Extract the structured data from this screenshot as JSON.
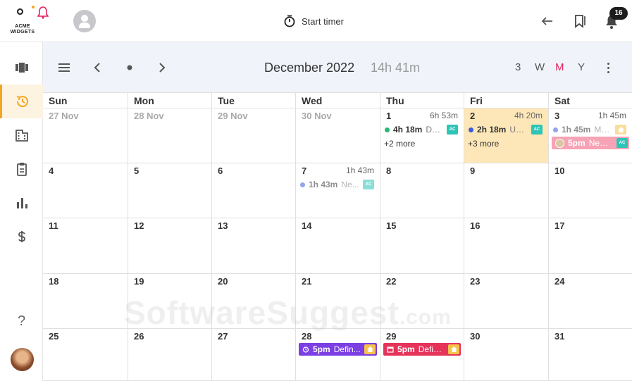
{
  "app": {
    "logo_text": "ACME WIDGETS",
    "notification_count": "16",
    "timer_label": "Start timer"
  },
  "toolbar": {
    "month_label": "December 2022",
    "total_time": "14h 41m",
    "views": [
      "3",
      "W",
      "M",
      "Y"
    ],
    "active_view": "M"
  },
  "weekdays": [
    "Sun",
    "Mon",
    "Tue",
    "Wed",
    "Thu",
    "Fri",
    "Sat"
  ],
  "weeks": [
    [
      {
        "day": "27 Nov",
        "muted": true
      },
      {
        "day": "28 Nov",
        "muted": true
      },
      {
        "day": "29 Nov",
        "muted": true
      },
      {
        "day": "30 Nov",
        "muted": true
      },
      {
        "day": "1",
        "duration": "6h 53m",
        "entries": [
          {
            "time": "4h 18m",
            "desc": "Defi...",
            "dot": "#2bb673",
            "tag": "AC"
          }
        ],
        "more": "+2 more"
      },
      {
        "day": "2",
        "duration": "4h 20m",
        "highlight": true,
        "entries": [
          {
            "time": "2h 18m",
            "desc": "Use...",
            "dot": "#3b5bdb",
            "tag": "AC"
          }
        ],
        "more": "+3 more"
      },
      {
        "day": "3",
        "duration": "1h 45m",
        "entries": [
          {
            "time": "1h 45m",
            "desc": "Mo...",
            "dot": "#3b5bdb",
            "icon": "house",
            "faded": true
          }
        ],
        "pills": [
          {
            "time": "5pm",
            "desc": "New ...",
            "style": "pink",
            "tag": "AC",
            "avatar": true
          }
        ]
      }
    ],
    [
      {
        "day": "4"
      },
      {
        "day": "5"
      },
      {
        "day": "6"
      },
      {
        "day": "7",
        "duration": "1h 43m",
        "entries": [
          {
            "time": "1h 43m",
            "desc": "Ne...",
            "dot": "#3b5bdb",
            "tag": "AC",
            "faded": true
          }
        ]
      },
      {
        "day": "8"
      },
      {
        "day": "9"
      },
      {
        "day": "10"
      }
    ],
    [
      {
        "day": "11"
      },
      {
        "day": "12"
      },
      {
        "day": "13"
      },
      {
        "day": "14"
      },
      {
        "day": "15"
      },
      {
        "day": "16"
      },
      {
        "day": "17"
      }
    ],
    [
      {
        "day": "18"
      },
      {
        "day": "19"
      },
      {
        "day": "20"
      },
      {
        "day": "21"
      },
      {
        "day": "22"
      },
      {
        "day": "23"
      },
      {
        "day": "24"
      }
    ],
    [
      {
        "day": "25"
      },
      {
        "day": "26"
      },
      {
        "day": "27"
      },
      {
        "day": "28",
        "pills": [
          {
            "time": "5pm",
            "desc": "Defin...",
            "style": "purple",
            "lead_icon": "alarm-icon",
            "icon": "house"
          }
        ]
      },
      {
        "day": "29",
        "pills": [
          {
            "time": "5pm",
            "desc": "Defin...",
            "style": "red",
            "lead_icon": "calendar-icon",
            "icon": "house"
          }
        ]
      },
      {
        "day": "30"
      },
      {
        "day": "31"
      }
    ]
  ],
  "watermark": {
    "main": "SoftwareSuggest",
    "suffix": ".com"
  },
  "colors": {
    "accent": "#f2a623",
    "active_view": "#e3245c",
    "highlight": "#fde7b8"
  }
}
